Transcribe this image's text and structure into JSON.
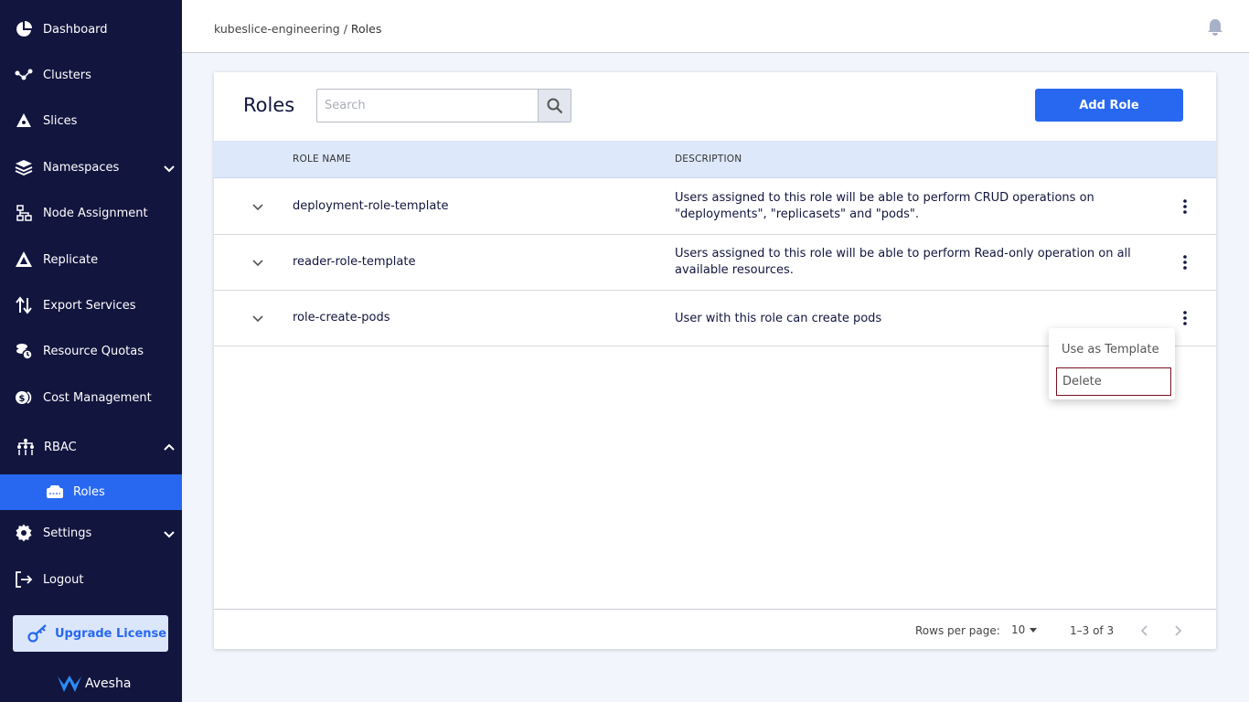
{
  "sidebar": {
    "items": [
      {
        "label": "Dashboard",
        "icon": "pie-chart-icon"
      },
      {
        "label": "Clusters",
        "icon": "cluster-icon"
      },
      {
        "label": "Slices",
        "icon": "slices-icon"
      },
      {
        "label": "Namespaces",
        "icon": "layers-icon",
        "expandable": true
      },
      {
        "label": "Node Assignment",
        "icon": "node-assignment-icon"
      },
      {
        "label": "Replicate",
        "icon": "replicate-icon"
      },
      {
        "label": "Export Services",
        "icon": "export-arrows-icon"
      },
      {
        "label": "Resource Quotas",
        "icon": "resource-quotas-icon"
      },
      {
        "label": "Cost Management",
        "icon": "cost-icon"
      },
      {
        "label": "RBAC",
        "icon": "rbac-icon",
        "expanded": true
      },
      {
        "label": "Roles",
        "icon": "roles-icon",
        "active": true
      },
      {
        "label": "Settings",
        "icon": "gear-icon",
        "expandable": true
      },
      {
        "label": "Logout",
        "icon": "logout-icon"
      }
    ],
    "upgrade_label": "Upgrade License",
    "brand": "Avesha"
  },
  "header": {
    "breadcrumb_parent": "kubeslice-engineering",
    "breadcrumb_sep": " / ",
    "breadcrumb_current": "Roles"
  },
  "main": {
    "title": "Roles",
    "search_placeholder": "Search",
    "add_button": "Add Role",
    "columns": {
      "name": "ROLE NAME",
      "description": "DESCRIPTION"
    },
    "rows": [
      {
        "name": "deployment-role-template",
        "description": "Users assigned to this role will be able to perform CRUD operations on \"deployments\", \"replicasets\" and \"pods\"."
      },
      {
        "name": "reader-role-template",
        "description": "Users assigned to this role will be able to perform Read-only operation on all available resources."
      },
      {
        "name": "role-create-pods",
        "description": "User with this role can create pods"
      }
    ],
    "pagination": {
      "rows_per_page_label": "Rows per page:",
      "rows_per_page": "10",
      "range": "1–3 of 3"
    }
  },
  "menu": {
    "items": [
      "Use as Template",
      "Delete"
    ]
  },
  "colors": {
    "sidebar_bg": "#12153e",
    "accent": "#2868f0",
    "table_header_bg": "#dde8fb"
  }
}
